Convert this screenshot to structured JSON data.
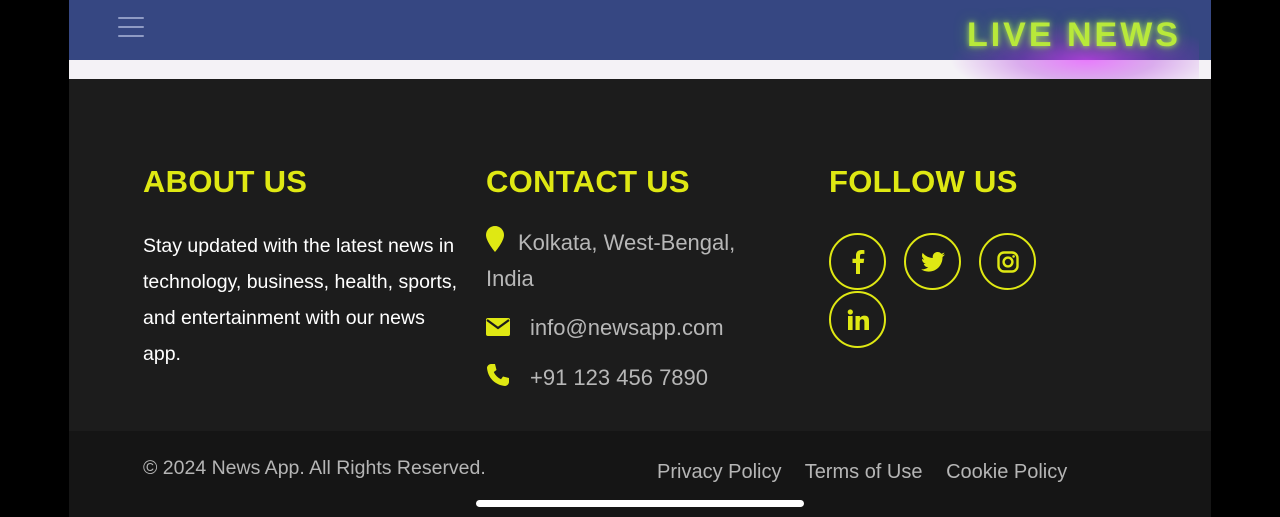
{
  "header": {
    "menu_icon": "hamburger-menu-icon",
    "live_badge": "LIVE NEWS"
  },
  "about": {
    "heading": "ABOUT US",
    "text": "Stay updated with the latest news in technology, business, health, sports, and entertainment with our news app."
  },
  "contact": {
    "heading": "CONTACT US",
    "address": "Kolkata, West-Bengal, India",
    "email": "info@newsapp.com",
    "phone": "+91 123 456 7890",
    "icons": [
      "location-pin-icon",
      "envelope-icon",
      "phone-icon"
    ]
  },
  "follow": {
    "heading": "FOLLOW US",
    "networks": [
      "facebook-icon",
      "twitter-icon",
      "instagram-icon",
      "linkedin-icon"
    ]
  },
  "bottom": {
    "copyright": "© 2024 News App. All Rights Reserved.",
    "links": [
      "Privacy Policy",
      "Terms of Use",
      "Cookie Policy"
    ]
  },
  "colors": {
    "accent": "#dfe813",
    "topbar": "#364782",
    "footer": "#1c1c1c",
    "live_glow": "#e13cff"
  }
}
